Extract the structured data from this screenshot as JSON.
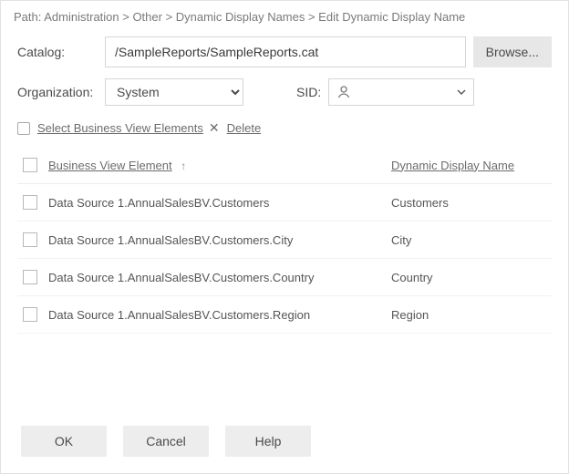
{
  "path": {
    "label": "Path:",
    "value": "Administration > Other > Dynamic Display Names > Edit Dynamic Display Name"
  },
  "catalog": {
    "label": "Catalog:",
    "value": "/SampleReports/SampleReports.cat",
    "browse": "Browse..."
  },
  "organization": {
    "label": "Organization:",
    "value": "System"
  },
  "sid": {
    "label": "SID:"
  },
  "actions": {
    "select_bve": "Select Business View Elements",
    "delete": "Delete"
  },
  "table": {
    "headers": {
      "bve": "Business View Element",
      "ddn": "Dynamic Display Name"
    },
    "sort_indicator": "↑",
    "rows": [
      {
        "bve": "Data Source 1.AnnualSalesBV.Customers",
        "ddn": "Customers"
      },
      {
        "bve": "Data Source 1.AnnualSalesBV.Customers.City",
        "ddn": "City"
      },
      {
        "bve": "Data Source 1.AnnualSalesBV.Customers.Country",
        "ddn": "Country"
      },
      {
        "bve": "Data Source 1.AnnualSalesBV.Customers.Region",
        "ddn": "Region"
      }
    ]
  },
  "footer": {
    "ok": "OK",
    "cancel": "Cancel",
    "help": "Help"
  }
}
